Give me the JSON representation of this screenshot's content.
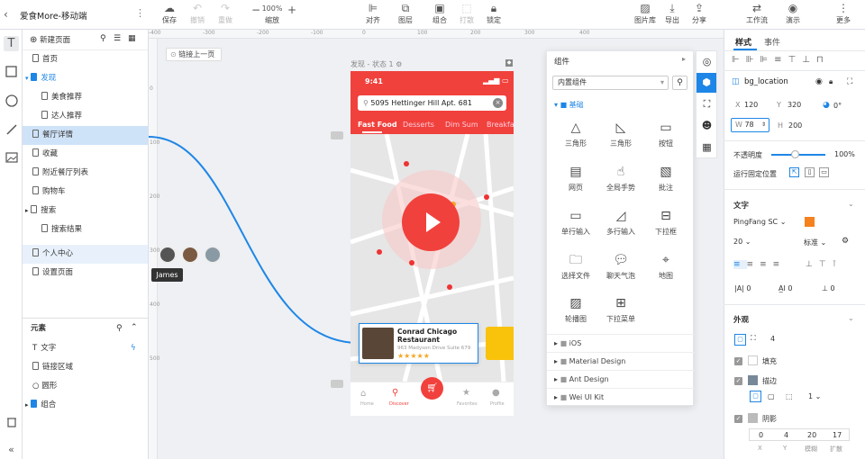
{
  "app": {
    "title": "爱食More-移动端"
  },
  "toolbar": {
    "save": "保存",
    "undo": "撤销",
    "redo": "重做",
    "zoom": "100%",
    "zoom_label": "缩放",
    "align": "对齐",
    "layer": "图层",
    "group": "组合",
    "ungroup": "打散",
    "lock": "锁定",
    "gallery": "图片库",
    "export": "导出",
    "share": "分享",
    "workflow": "工作流",
    "present": "演示",
    "more": "更多"
  },
  "pages": {
    "new_page": "新建页面",
    "items": [
      {
        "label": "首页"
      },
      {
        "label": "发现"
      },
      {
        "label": "美食推荐"
      },
      {
        "label": "达人推荐"
      },
      {
        "label": "餐厅详情"
      },
      {
        "label": "收藏"
      },
      {
        "label": "附近餐厅列表"
      },
      {
        "label": "购物车"
      },
      {
        "label": "搜索"
      },
      {
        "label": "搜索结果"
      },
      {
        "label": "个人中心"
      },
      {
        "label": "设置页面"
      }
    ]
  },
  "elements": {
    "title": "元素",
    "items": [
      {
        "label": "文字"
      },
      {
        "label": "链接区域"
      },
      {
        "label": "圆形"
      },
      {
        "label": "组合"
      }
    ]
  },
  "canvas": {
    "link_prev": "链接上一页",
    "frame_label": "发现 - 状态 1",
    "tooltip": "James",
    "ruler_h": [
      "-400",
      "-300",
      "-200",
      "-100",
      "0",
      "100",
      "200",
      "300",
      "400"
    ],
    "ruler_v": [
      "0",
      "100",
      "200",
      "300",
      "400",
      "500"
    ]
  },
  "phone": {
    "time": "9:41",
    "search": "5095 Hettinger Hill Apt. 681",
    "tabs": [
      "Fast Food",
      "Desserts",
      "Dim Sum",
      "Breakfa"
    ],
    "card_title": "Conrad Chicago Restaurant",
    "card_addr": "963 Madyson Drive Suite 679",
    "stars": "★★★★★",
    "nav": [
      "Home",
      "Discover",
      "",
      "Favorites",
      "Profile"
    ]
  },
  "components": {
    "title": "组件",
    "source": "内置组件",
    "basic": "基础",
    "items": [
      "三角形",
      "三角形",
      "按钮",
      "网页",
      "全局手势",
      "批注",
      "单行输入",
      "多行输入",
      "下拉框",
      "选择文件",
      "聊天气泡",
      "地图",
      "轮播图",
      "下拉菜单"
    ],
    "libs": [
      "iOS",
      "Material Design",
      "Ant Design",
      "Wei UI Kit"
    ]
  },
  "props": {
    "tab_style": "样式",
    "tab_event": "事件",
    "name": "bg_location",
    "x_label": "X",
    "x": "120",
    "y_label": "Y",
    "y": "320",
    "rot": "0°",
    "w_label": "W",
    "w": "78",
    "h_label": "H",
    "h": "200",
    "opacity_label": "不透明度",
    "opacity": "100%",
    "opacity_value": 1,
    "fixed_label": "运行固定位置",
    "text_section": "文字",
    "font": "PingFang SC",
    "font_size": "20",
    "weight": "标准",
    "spacing": [
      "0",
      "0",
      "0"
    ],
    "appearance": "外观",
    "radius": "4",
    "fill": "填充",
    "stroke": "描边",
    "stroke_w": "1",
    "shadow": "阴影",
    "shadow_vals": [
      "0",
      "4",
      "20",
      "17"
    ],
    "shadow_labels": [
      "X",
      "Y",
      "模糊",
      "扩散"
    ]
  },
  "colors": {
    "accent": "#1e86e6",
    "brand_red": "#f1413c",
    "orange": "#f5811f"
  }
}
